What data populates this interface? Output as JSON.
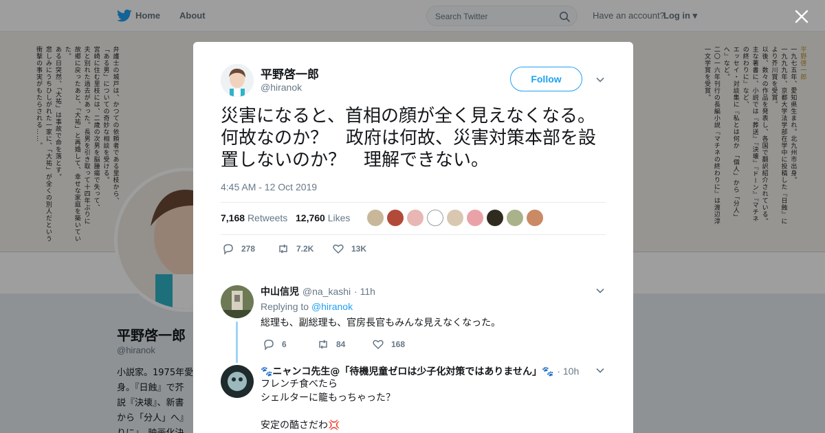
{
  "nav": {
    "home_label": "Home",
    "about_label": "About",
    "search_placeholder": "Search Twitter",
    "have_account": "Have an account?",
    "login_label": "Log in"
  },
  "background_profile": {
    "name": "平野啓一郎",
    "handle": "@hiranok",
    "bio": "小説家。1975年愛\n身。『日蝕』で芥\n説『決壊』、新書\nから「分人」へ』\nりに』、映画化決"
  },
  "banner": {
    "col_left_1": "弁護士の城戸は、かつての依頼者である里枝から、",
    "col_left_2": "「ある男」についての奇妙な相談を受ける。",
    "col_left_3": "宮崎に住む里枝には、二歳の次男を脳腫瘍で失って、",
    "col_left_4": "夫と別れた過去があった。長男を引き取って十四年ぶりに",
    "col_left_5": "故郷に戻ったあと、「大祐」と再婚して、幸せな家庭を築いていた。",
    "col_left_6": "ある日突然、「大祐」は事故で命を落とす。",
    "col_left_7": "悲しみにうちひしがれた一家に、「大祐」が全くの別人だという",
    "col_left_8": "衝撃の事実がもたらされる……。",
    "col_right_1": "平野啓一郎",
    "col_right_2": "一九七五年、愛知県生まれ。北九州市出身。",
    "col_right_3": "一九九九年、京都大学法学部在学中に投稿した『日蝕』により芥川賞を受賞。",
    "col_right_4": "以後、数々の作品を発表し、各国で翻訳紹介されている。",
    "col_right_5": "主な著書に、小説では『葬送』『決壊』『ドーン』『マチネの終わりに』など、",
    "col_right_6": "エッセイ・対談集に『私とは何か 「個人」から「分人」へ』など。",
    "col_right_7": "二〇一六年刊行の長編小説『マチネの終わりに』は渡辺淳一文学賞を受賞。"
  },
  "tweet": {
    "author_name": "平野啓一郎",
    "author_handle": "@hiranok",
    "follow_label": "Follow",
    "text": "災害になると、首相の顔が全く見えなくなる。何故なのか？　政府は何故、災害対策本部を設置しないのか？　理解できない。",
    "timestamp": "4:45 AM - 12 Oct 2019",
    "retweets_count": "7,168",
    "retweets_label": "Retweets",
    "likes_count": "12,760",
    "likes_label": "Likes",
    "actions": {
      "replies": "278",
      "retweets": "7.2K",
      "likes": "13K"
    }
  },
  "replies": [
    {
      "name": "中山信児",
      "handle": "@na_kashi",
      "time": "· 11h",
      "replying_prefix": "Replying to",
      "replying_to": "@hiranok",
      "text": "総理も、副総理も、官房長官もみんな見えなくなった。",
      "replies": "6",
      "retweets": "84",
      "likes": "168"
    },
    {
      "name": "🐾ニャンコ先生@「待機児童ゼロは少子化対策ではありません」🐾",
      "time": "· 10h",
      "text_line1": "フレンチ食べたら",
      "text_line2": "シェルターに籠もっちゃった？",
      "text_line3": "安定の酷さだわ💢"
    }
  ],
  "colors": {
    "accent": "#1da1f2",
    "text_primary": "#14171a",
    "text_secondary": "#657786",
    "thread_line": "#9fd3f4"
  }
}
